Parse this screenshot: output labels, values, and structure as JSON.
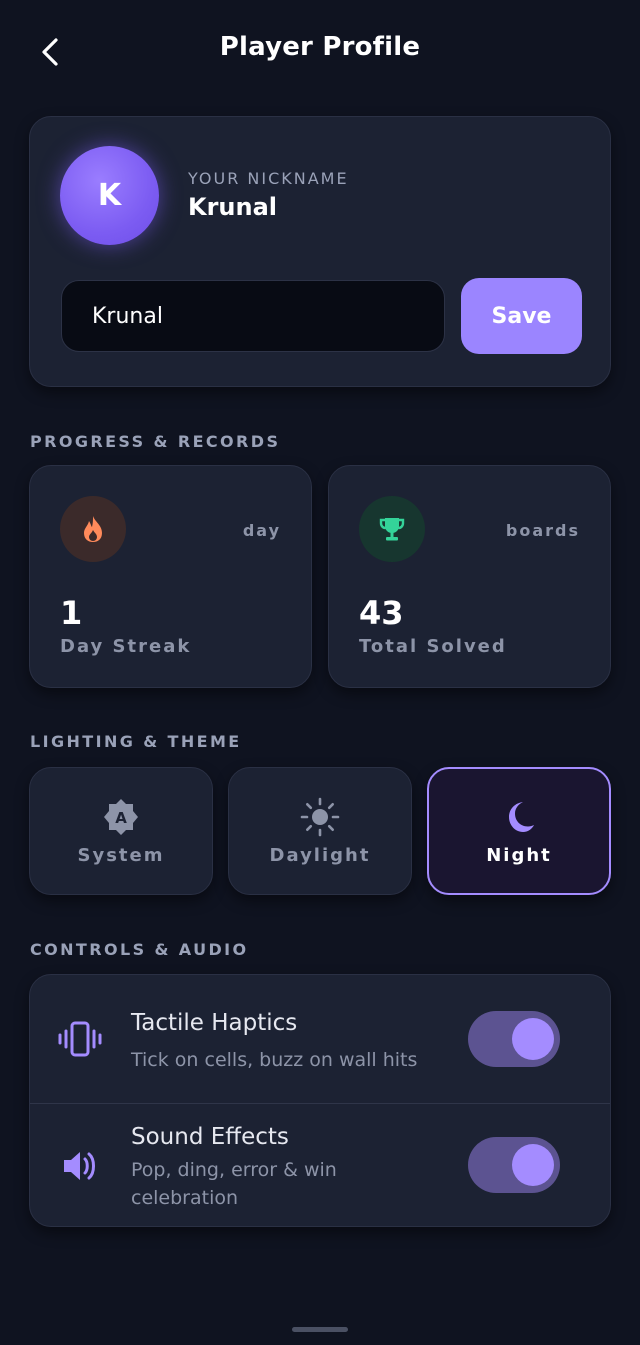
{
  "header": {
    "title": "Player Profile",
    "back_icon": "chevron-left-icon"
  },
  "profile": {
    "avatar_initial": "K",
    "nickname_label": "YOUR NICKNAME",
    "nickname": "Krunal",
    "input_value": "Krunal",
    "save_label": "Save"
  },
  "sections": {
    "progress": "PROGRESS & RECORDS",
    "theme": "LIGHTING & THEME",
    "controls": "CONTROLS & AUDIO"
  },
  "stats": [
    {
      "icon": "flame-icon",
      "unit": "day",
      "value": "1",
      "label": "Day Streak",
      "icon_color": "#ff8a5b",
      "icon_bg": "#3b2a2a"
    },
    {
      "icon": "trophy-icon",
      "unit": "boards",
      "value": "43",
      "label": "Total Solved",
      "icon_color": "#34d399",
      "icon_bg": "#17362f"
    }
  ],
  "themes": [
    {
      "icon": "auto-theme-icon",
      "label": "System",
      "selected": false
    },
    {
      "icon": "sun-icon",
      "label": "Daylight",
      "selected": false
    },
    {
      "icon": "moon-icon",
      "label": "Night",
      "selected": true
    }
  ],
  "controls": [
    {
      "icon": "vibration-icon",
      "title": "Tactile Haptics",
      "subtitle": "Tick on cells, buzz on wall hits",
      "enabled": true
    },
    {
      "icon": "speaker-icon",
      "title": "Sound Effects",
      "subtitle": "Pop, ding, error & win celebration",
      "enabled": true
    }
  ],
  "colors": {
    "background": "#0f1320",
    "card": "#1c2233",
    "accent": "#9b85ff",
    "accent_border": "#a48cff",
    "toggle_track": "#5c5391"
  }
}
